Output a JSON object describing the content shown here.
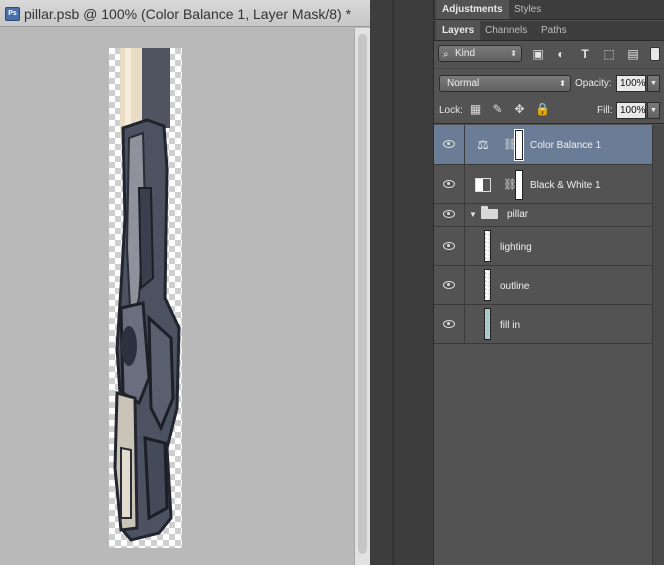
{
  "document": {
    "title": "pillar.psb @ 100% (Color Balance 1, Layer Mask/8) *",
    "icon": "ps-document-icon"
  },
  "panels": {
    "top_tabs": [
      {
        "label": "Adjustments",
        "active": true
      },
      {
        "label": "Styles",
        "active": false
      }
    ],
    "layer_tabs": [
      {
        "label": "Layers",
        "active": true
      },
      {
        "label": "Channels",
        "active": false
      },
      {
        "label": "Paths",
        "active": false
      }
    ],
    "filter": {
      "kind_label": "Kind",
      "icons": [
        "image-filter-icon",
        "adjustment-filter-icon",
        "type-filter-icon",
        "shape-filter-icon",
        "smart-object-filter-icon"
      ]
    },
    "blend": {
      "mode": "Normal",
      "opacity_label": "Opacity:",
      "opacity_value": "100%"
    },
    "lock": {
      "label": "Lock:",
      "icons": [
        "lock-transparent-icon",
        "lock-image-icon",
        "lock-position-icon",
        "lock-all-icon"
      ],
      "fill_label": "Fill:",
      "fill_value": "100%"
    },
    "layers": [
      {
        "name": "Color Balance 1",
        "type": "adjustment",
        "visible": true,
        "selected": true
      },
      {
        "name": "Black & White 1",
        "type": "adjustment",
        "visible": true,
        "selected": false
      },
      {
        "name": "pillar",
        "type": "group",
        "visible": true,
        "selected": false,
        "expanded": true
      },
      {
        "name": "lighting",
        "type": "layer",
        "visible": true,
        "selected": false
      },
      {
        "name": "outline",
        "type": "layer",
        "visible": true,
        "selected": false
      },
      {
        "name": "fill in",
        "type": "layer",
        "visible": true,
        "selected": false
      }
    ]
  },
  "colors": {
    "selected_layer": "#6b7d96",
    "panel_bg": "#535353",
    "canvas_bg": "#b9b9b9"
  }
}
